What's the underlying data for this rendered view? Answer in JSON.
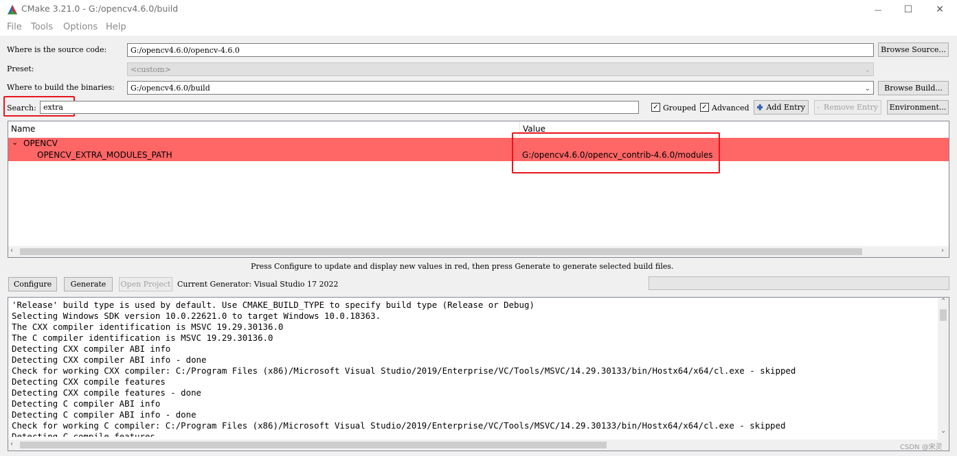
{
  "window": {
    "title": "CMake 3.21.0 - G:/opencv4.6.0/build",
    "minimize_glyph": "—",
    "maximize_glyph": "☐",
    "close_glyph": "✕"
  },
  "menu": [
    "File",
    "Tools",
    "Options",
    "Help"
  ],
  "source": {
    "label": "Where is the source code:",
    "value": "G:/opencv4.6.0/opencv-4.6.0",
    "browse_label": "Browse Source..."
  },
  "preset": {
    "label": "Preset:",
    "value": "<custom>"
  },
  "build": {
    "label": "Where to build the binaries:",
    "value": "G:/opencv4.6.0/build",
    "browse_label": "Browse Build..."
  },
  "search": {
    "label": "Search:",
    "value": "extra"
  },
  "options": {
    "grouped_label": "Grouped",
    "grouped_checked": true,
    "advanced_label": "Advanced",
    "advanced_checked": true,
    "add_entry_label": "Add Entry",
    "remove_entry_label": "Remove Entry",
    "environment_label": "Environment..."
  },
  "tree": {
    "col_name": "Name",
    "col_value": "Value",
    "group": "OPENCV",
    "entry_name": "OPENCV_EXTRA_MODULES_PATH",
    "entry_value": "G:/opencv4.6.0/opencv_contrib-4.6.0/modules",
    "highlight_color": "#ff6666"
  },
  "hint": "Press Configure to update and display new values in red, then press Generate to generate selected build files.",
  "actions": {
    "configure_label": "Configure",
    "generate_label": "Generate",
    "open_project_label": "Open Project",
    "generator_text": "Current Generator: Visual Studio 17 2022"
  },
  "log_lines": [
    "'Release' build type is used by default. Use CMAKE_BUILD_TYPE to specify build type (Release or Debug)",
    "Selecting Windows SDK version 10.0.22621.0 to target Windows 10.0.18363.",
    "The CXX compiler identification is MSVC 19.29.30136.0",
    "The C compiler identification is MSVC 19.29.30136.0",
    "Detecting CXX compiler ABI info",
    "Detecting CXX compiler ABI info - done",
    "Check for working CXX compiler: C:/Program Files (x86)/Microsoft Visual Studio/2019/Enterprise/VC/Tools/MSVC/14.29.30133/bin/Hostx64/x64/cl.exe - skipped",
    "Detecting CXX compile features",
    "Detecting CXX compile features - done",
    "Detecting C compiler ABI info",
    "Detecting C compiler ABI info - done",
    "Check for working C compiler: C:/Program Files (x86)/Microsoft Visual Studio/2019/Enterprise/VC/Tools/MSVC/14.29.30133/bin/Hostx64/x64/cl.exe - skipped",
    "Detecting C compile features"
  ],
  "watermark": "CSDN @宋灵"
}
